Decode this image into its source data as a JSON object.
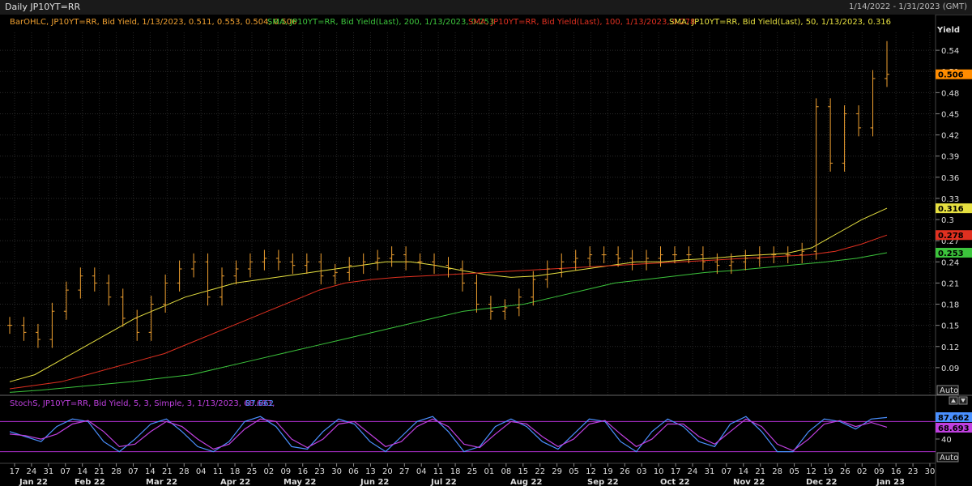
{
  "window": {
    "title": "Daily JP10YT=RR",
    "date_range": "1/14/2022 - 1/31/2023 (GMT)"
  },
  "main_panel": {
    "legend": {
      "barohlc": "BarOHLC, JP10YT=RR, Bid Yield, 1/13/2023, 0.511, 0.553, 0.504, 0.506",
      "sma200": "SMA, JP10YT=RR, Bid Yield(Last), 200, 1/13/2023, 0.253",
      "sma100": "SMA, JP10YT=RR, Bid Yield(Last), 100, 1/13/2023, 0.278",
      "sma50": "SMA, JP10YT=RR, Bid Yield(Last), 50, 1/13/2023, 0.316"
    },
    "axis_title": "Yield",
    "auto_label": "Auto"
  },
  "stoch_panel": {
    "legend_prefix": "StochS, JP10YT=RR, Bid Yield, 5, 3, Simple, 3, 1/13/2023, 68.693,",
    "legend_value": "87.662",
    "auto_label": "Auto",
    "tick_label": "40"
  },
  "colors": {
    "bars": "#f0a030",
    "sma200": "#3cc43c",
    "sma100": "#e03020",
    "sma50": "#e6e040",
    "stoch_k": "#4a90ff",
    "stoch_d": "#c040e0",
    "band_line": "#b030d0"
  },
  "chart_data": [
    {
      "type": "line",
      "title": "Daily JP10YT=RR",
      "ylabel": "Yield",
      "ylim": [
        0.06,
        0.57
      ],
      "y_ticks": [
        "0.54",
        "0.51",
        "0.48",
        "0.45",
        "0.42",
        "0.39",
        "0.36",
        "0.33",
        "0.3",
        "0.27",
        "0.24",
        "0.21",
        "0.18",
        "0.15",
        "0.12",
        "0.09"
      ],
      "grid": true,
      "x_ticks": [
        "17",
        "24",
        "31",
        "07",
        "14",
        "21",
        "28",
        "07",
        "14",
        "21",
        "28",
        "04",
        "11",
        "18",
        "25",
        "02",
        "09",
        "16",
        "23",
        "30",
        "06",
        "13",
        "20",
        "27",
        "04",
        "11",
        "18",
        "25",
        "01",
        "08",
        "15",
        "22",
        "29",
        "05",
        "12",
        "19",
        "26",
        "03",
        "10",
        "17",
        "24",
        "31",
        "07",
        "14",
        "21",
        "28",
        "05",
        "12",
        "19",
        "26",
        "02",
        "09",
        "16",
        "23",
        "30"
      ],
      "month_labels": [
        "Jan 22",
        "Feb 22",
        "Mar 22",
        "Apr 22",
        "May 22",
        "Jun 22",
        "Jul 22",
        "Aug 22",
        "Sep 22",
        "Oct 22",
        "Nov 22",
        "Dec 22",
        "Jan 23"
      ],
      "current_value_tags": [
        {
          "label": "0.506",
          "value": 0.506,
          "color": "#ff8c00"
        },
        {
          "label": "0.316",
          "value": 0.316,
          "color": "#e6e040"
        },
        {
          "label": "0.278",
          "value": 0.278,
          "color": "#e03020"
        },
        {
          "label": "0.253",
          "value": 0.253,
          "color": "#3cc43c"
        }
      ],
      "bar_ohlc_closes_weekly": [
        0.15,
        0.14,
        0.13,
        0.17,
        0.2,
        0.22,
        0.21,
        0.19,
        0.16,
        0.14,
        0.18,
        0.21,
        0.23,
        0.24,
        0.19,
        0.22,
        0.23,
        0.24,
        0.245,
        0.24,
        0.235,
        0.24,
        0.22,
        0.225,
        0.235,
        0.24,
        0.245,
        0.25,
        0.24,
        0.24,
        0.235,
        0.23,
        0.21,
        0.18,
        0.17,
        0.175,
        0.19,
        0.215,
        0.23,
        0.24,
        0.245,
        0.25,
        0.25,
        0.245,
        0.24,
        0.245,
        0.25,
        0.25,
        0.25,
        0.24,
        0.235,
        0.24,
        0.245,
        0.25,
        0.25,
        0.25,
        0.255,
        0.46,
        0.38,
        0.45,
        0.43,
        0.5,
        0.506
      ],
      "series": [
        {
          "name": "SMA 50",
          "values": [
            0.07,
            0.08,
            0.1,
            0.12,
            0.14,
            0.16,
            0.175,
            0.19,
            0.2,
            0.21,
            0.215,
            0.22,
            0.225,
            0.23,
            0.235,
            0.24,
            0.24,
            0.235,
            0.228,
            0.222,
            0.218,
            0.22,
            0.225,
            0.23,
            0.235,
            0.24,
            0.24,
            0.243,
            0.245,
            0.248,
            0.25,
            0.252,
            0.26,
            0.28,
            0.3,
            0.316
          ]
        },
        {
          "name": "SMA 100",
          "values": [
            0.06,
            0.065,
            0.07,
            0.08,
            0.09,
            0.1,
            0.11,
            0.125,
            0.14,
            0.155,
            0.17,
            0.185,
            0.2,
            0.21,
            0.215,
            0.218,
            0.22,
            0.222,
            0.224,
            0.226,
            0.228,
            0.23,
            0.232,
            0.234,
            0.236,
            0.238,
            0.24,
            0.242,
            0.244,
            0.246,
            0.248,
            0.25,
            0.255,
            0.265,
            0.278
          ]
        },
        {
          "name": "SMA 200",
          "values": [
            0.055,
            0.058,
            0.062,
            0.066,
            0.07,
            0.075,
            0.08,
            0.09,
            0.1,
            0.11,
            0.12,
            0.13,
            0.14,
            0.15,
            0.16,
            0.17,
            0.175,
            0.18,
            0.19,
            0.2,
            0.21,
            0.215,
            0.22,
            0.225,
            0.228,
            0.232,
            0.236,
            0.24,
            0.245,
            0.253
          ]
        }
      ]
    },
    {
      "type": "line",
      "title": "StochS",
      "ylim": [
        0,
        100
      ],
      "y_ticks": [
        "40"
      ],
      "reference_lines": [
        80,
        20
      ],
      "series": [
        {
          "name": "%K",
          "values": [
            60,
            50,
            40,
            70,
            85,
            80,
            40,
            20,
            45,
            75,
            85,
            60,
            30,
            20,
            40,
            80,
            90,
            70,
            30,
            25,
            60,
            85,
            75,
            40,
            20,
            50,
            80,
            90,
            60,
            20,
            30,
            70,
            85,
            70,
            40,
            25,
            55,
            85,
            80,
            40,
            20,
            60,
            85,
            70,
            40,
            30,
            75,
            90,
            60,
            20,
            20,
            60,
            85,
            80,
            65,
            85,
            88
          ]
        },
        {
          "name": "%D",
          "values": [
            55,
            52,
            45,
            55,
            75,
            82,
            60,
            30,
            35,
            60,
            80,
            70,
            45,
            25,
            35,
            65,
            85,
            80,
            45,
            28,
            45,
            75,
            80,
            55,
            30,
            40,
            70,
            85,
            70,
            35,
            28,
            55,
            80,
            75,
            50,
            30,
            45,
            75,
            82,
            55,
            30,
            45,
            75,
            75,
            50,
            35,
            60,
            85,
            70,
            35,
            22,
            45,
            75,
            82,
            70,
            78,
            68.693
          ]
        }
      ]
    }
  ]
}
